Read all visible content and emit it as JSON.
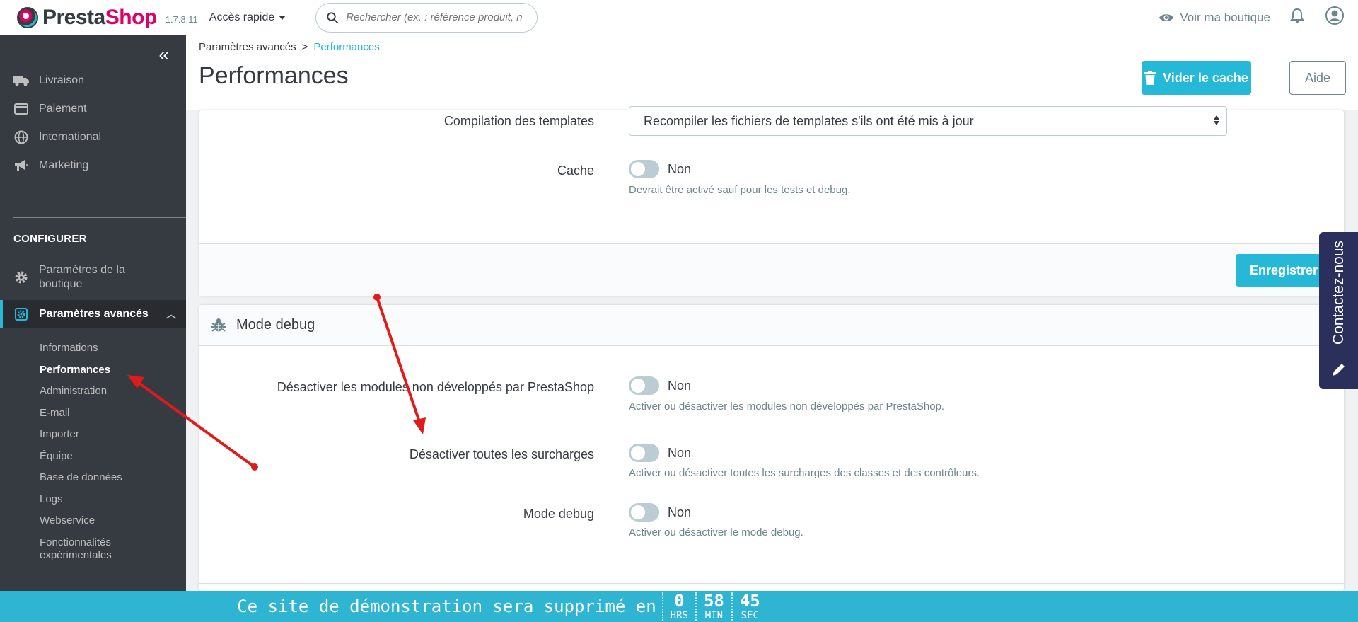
{
  "header": {
    "logo_pre": "Presta",
    "logo_post": "Shop",
    "version": "1.7.8.11",
    "quick_access": "Accès rapide",
    "search_placeholder": "Rechercher (ex. : référence produit, no",
    "view_shop": "Voir ma boutique"
  },
  "sidebar": {
    "top_items": [
      "Livraison",
      "Paiement",
      "International",
      "Marketing"
    ],
    "section_title": "CONFIGURER",
    "shop_params": "Paramètres de la boutique",
    "advanced_params": "Paramètres avancés",
    "sub_items": [
      "Informations",
      "Performances",
      "Administration",
      "E-mail",
      "Importer",
      "Équipe",
      "Base de données",
      "Logs",
      "Webservice",
      "Fonctionnalités expérimentales"
    ]
  },
  "page": {
    "breadcrumb_parent": "Paramètres avancés",
    "breadcrumb_sep": ">",
    "breadcrumb_current": "Performances",
    "title": "Performances",
    "clear_cache": "Vider le cache",
    "help": "Aide"
  },
  "smarty_panel": {
    "compile_label": "Compilation des templates",
    "compile_value": "Recompiler les fichiers de templates s'ils ont été mis à jour",
    "cache_label": "Cache",
    "cache_value": "Non",
    "cache_help": "Devrait être activé sauf pour les tests et debug.",
    "save": "Enregistrer"
  },
  "debug_panel": {
    "title": "Mode debug",
    "modules_label": "Désactiver les modules non développés par PrestaShop",
    "modules_value": "Non",
    "modules_help": "Activer ou désactiver les modules non développés par PrestaShop.",
    "overrides_label": "Désactiver toutes les surcharges",
    "overrides_value": "Non",
    "overrides_help": "Activer ou désactiver toutes les surcharges des classes et des contrôleurs.",
    "debug_label": "Mode debug",
    "debug_value": "Non",
    "debug_help": "Activer ou désactiver le mode debug."
  },
  "contact_tab": "Contactez-nous",
  "demo_bar": {
    "message": "Ce site de démonstration sera supprimé en",
    "hours": "0",
    "hours_unit": "HRS",
    "minutes": "58",
    "minutes_unit": "MIN",
    "seconds": "45",
    "seconds_unit": "SEC"
  },
  "colors": {
    "accent": "#25b9d7",
    "sidebar_bg": "#363a41",
    "brand_pink": "#df0067",
    "contact_bg": "#2a2f5c",
    "annotation_red": "#e01b1b"
  }
}
